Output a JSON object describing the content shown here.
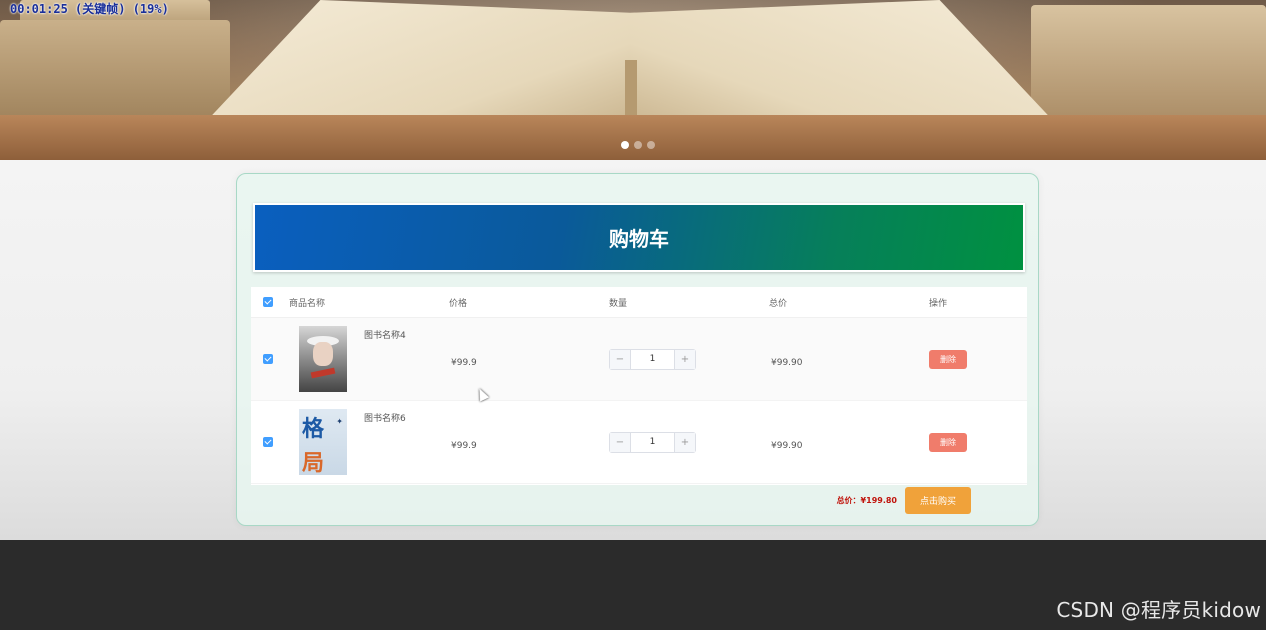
{
  "recording": {
    "timer": "00:01:25 (关键帧) (19%)"
  },
  "carousel": {
    "slides": 3,
    "active_index": 0
  },
  "cart": {
    "title": "购物车",
    "columns": {
      "name": "商品名称",
      "price": "价格",
      "quantity": "数量",
      "total": "总价",
      "action": "操作"
    },
    "items": [
      {
        "name": "图书名称4",
        "price": "¥99.9",
        "quantity": "1",
        "total": "¥99.90",
        "delete_label": "删除",
        "checked": true,
        "cover_icon": "book-cover-portrait"
      },
      {
        "name": "图书名称6",
        "price": "¥99.9",
        "quantity": "1",
        "total": "¥99.90",
        "delete_label": "删除",
        "checked": true,
        "cover_icon": "book-cover-ge-ju",
        "cover_text_1": "格",
        "cover_text_2": "局"
      }
    ],
    "minus_symbol": "−",
    "plus_symbol": "+",
    "summary_label": "总价：¥199.80",
    "buy_label": "点击购买"
  },
  "watermark": "CSDN @程序员kidow",
  "colors": {
    "title_gradient_start": "#0a5fbf",
    "title_gradient_end": "#009140",
    "checkbox": "#409eff",
    "delete_button": "#f07c6b",
    "buy_button": "#f0a23a",
    "total_price": "#c0140c"
  }
}
